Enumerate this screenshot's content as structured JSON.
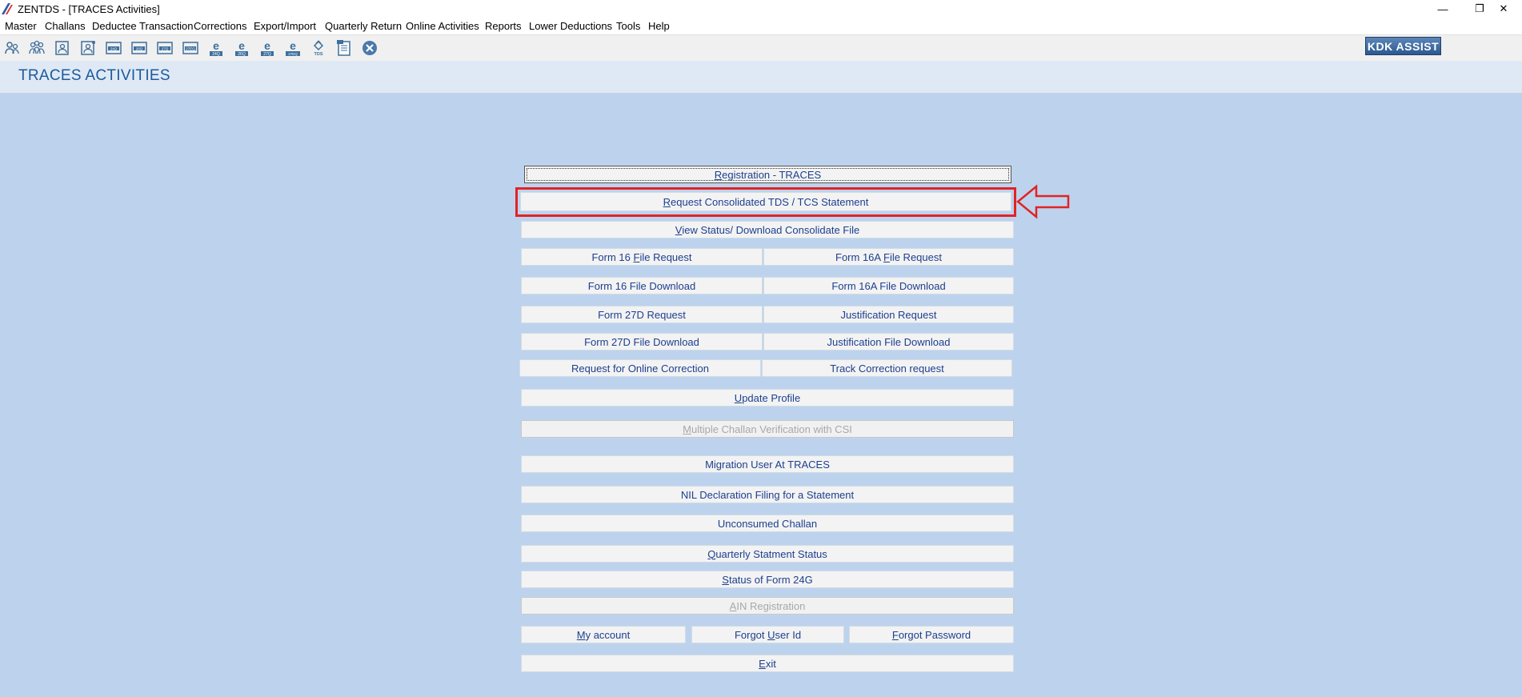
{
  "window": {
    "title": "ZENTDS - [TRACES Activities]",
    "controls": [
      "—",
      "❐",
      "✕"
    ]
  },
  "menu": [
    "Master",
    "Challans",
    "Deductee Transaction",
    "Corrections",
    "Export/Import",
    "Quarterly Return",
    "Online Activities",
    "Reports",
    "Lower Deductions",
    "Tools",
    "Help"
  ],
  "toolbar": {
    "icons": [
      "user-icon",
      "users-icon",
      "deductee-icon",
      "deductee-add-icon",
      "form-24q-icon",
      "form-26q-icon",
      "form-27q-icon",
      "form-27eq-icon",
      "e-24q-icon",
      "e-26q-icon",
      "e-27q-icon",
      "e-27eq-icon",
      "tds-icon",
      "document-icon",
      "close-circle-icon"
    ],
    "icon_labels": [
      "",
      "",
      "",
      "",
      "24Q",
      "26Q",
      "27Q",
      "27EQ",
      "24Q",
      "26Q",
      "27Q",
      "27EQ",
      "TDS",
      "",
      ""
    ],
    "kdk_assist": "KDK ASSIST"
  },
  "page": {
    "title": "TRACES ACTIVITIES"
  },
  "buttons": {
    "registration": {
      "u": "R",
      "rest": "egistration - TRACES"
    },
    "request_consolidated": {
      "u": "R",
      "rest": "equest Consolidated TDS / TCS Statement"
    },
    "view_status": {
      "pre": "",
      "u": "V",
      "rest": "iew Status/ Download Consolidate File"
    },
    "form16_request": {
      "pre": "Form 16 ",
      "u": "F",
      "rest": "ile Request"
    },
    "form16a_request": {
      "pre": "Form 16A ",
      "u": "F",
      "rest": "ile Request"
    },
    "form16_download": "Form 16 File Download",
    "form16a_download": "Form 16A File Download",
    "form27d_request": "Form 27D Request",
    "justification_request": "Justification Request",
    "form27d_download": "Form 27D File Download",
    "justification_download": "Justification File Download",
    "online_correction": "Request for Online Correction",
    "track_correction": "Track Correction request",
    "update_profile": {
      "u": "U",
      "rest": "pdate Profile"
    },
    "multiple_challan": {
      "u": "M",
      "rest": "ultiple Challan Verification with CSI"
    },
    "migration_user": "Migration User At TRACES",
    "nil_declaration": "NIL Declaration Filing for a Statement",
    "unconsumed_challan": "Unconsumed Challan",
    "quarterly_status": {
      "u": "Q",
      "rest": "uarterly Statment Status"
    },
    "status_24g": {
      "u": "S",
      "rest": "tatus of Form 24G"
    },
    "ain_registration": {
      "u": "A",
      "rest": "IN Registration"
    },
    "my_account": {
      "u": "M",
      "rest": "y account"
    },
    "forgot_user": {
      "pre": "Forgot ",
      "u": "U",
      "rest": "ser Id"
    },
    "forgot_password": {
      "u": "F",
      "rest": "orgot Password"
    },
    "exit": {
      "u": "E",
      "rest": "xit"
    }
  },
  "colors": {
    "background": "#bdd3ed",
    "header_band": "#dfe9f5",
    "title": "#1b5a9c",
    "button_text": "#1d3f8f",
    "highlight": "#e02424"
  }
}
